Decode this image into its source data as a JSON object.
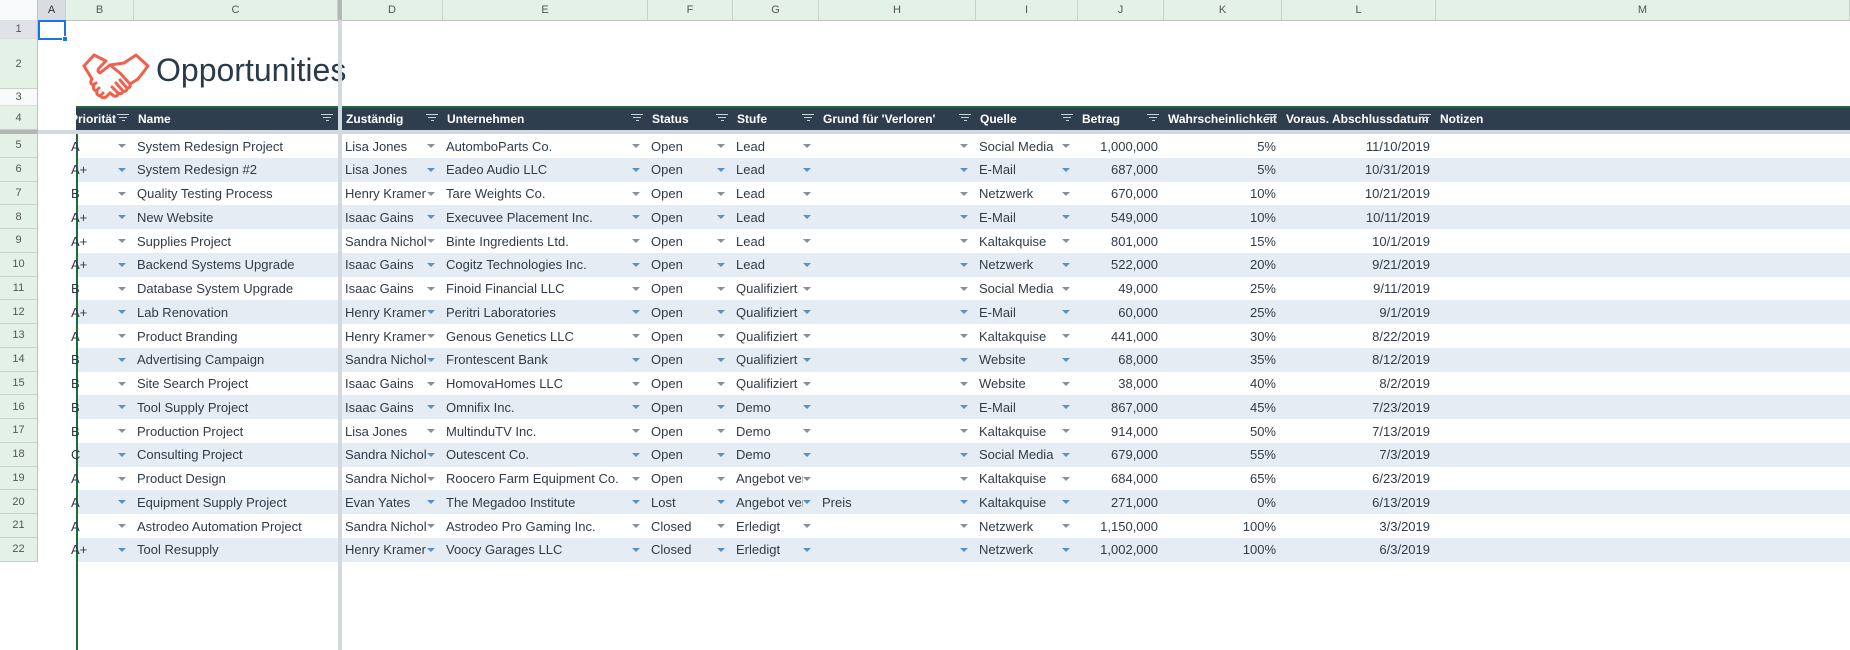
{
  "sheet": {
    "columns": [
      "A",
      "B",
      "C",
      "D",
      "E",
      "F",
      "G",
      "H",
      "I",
      "J",
      "K",
      "L",
      "M"
    ],
    "row_numbers": [
      "1",
      "2",
      "3",
      "4",
      "5",
      "6",
      "7",
      "8",
      "9",
      "10",
      "11",
      "12",
      "13",
      "14",
      "15",
      "16",
      "17",
      "18",
      "19",
      "20",
      "21",
      "22"
    ],
    "selected_cell": "A1"
  },
  "title": {
    "text": "Opportunities",
    "icon": "handshake-icon",
    "icon_color": "#f0604d"
  },
  "table": {
    "headers": [
      "Priorität",
      "Name",
      "Zuständig",
      "Unternehmen",
      "Status",
      "Stufe",
      "Grund für 'Verloren'",
      "Quelle",
      "Betrag",
      "Wahrscheinlichkeit",
      "Voraus. Abschlussdatum",
      "Notizen"
    ],
    "rows": [
      {
        "prio": "A",
        "name": "System Redesign Project",
        "owner": "Lisa Jones",
        "company": "AutomboParts Co.",
        "status": "Open",
        "stage": "Lead",
        "lost_reason": "",
        "source": "Social Media",
        "amount": "1,000,000",
        "probability": "5%",
        "close_date": "11/10/2019",
        "notes": ""
      },
      {
        "prio": "A+",
        "name": "System Redesign #2",
        "owner": "Lisa Jones",
        "company": "Eadeo Audio LLC",
        "status": "Open",
        "stage": "Lead",
        "lost_reason": "",
        "source": "E-Mail",
        "amount": "687,000",
        "probability": "5%",
        "close_date": "10/31/2019",
        "notes": ""
      },
      {
        "prio": "B",
        "name": "Quality Testing Process",
        "owner": "Henry Kramer",
        "company": "Tare Weights Co.",
        "status": "Open",
        "stage": "Lead",
        "lost_reason": "",
        "source": "Netzwerk",
        "amount": "670,000",
        "probability": "10%",
        "close_date": "10/21/2019",
        "notes": ""
      },
      {
        "prio": "A+",
        "name": "New Website",
        "owner": "Isaac Gains",
        "company": "Execuvee Placement Inc.",
        "status": "Open",
        "stage": "Lead",
        "lost_reason": "",
        "source": "E-Mail",
        "amount": "549,000",
        "probability": "10%",
        "close_date": "10/11/2019",
        "notes": ""
      },
      {
        "prio": "A+",
        "name": "Supplies Project",
        "owner": "Sandra Nichols",
        "company": "Binte Ingredients Ltd.",
        "status": "Open",
        "stage": "Lead",
        "lost_reason": "",
        "source": "Kaltakquise",
        "amount": "801,000",
        "probability": "15%",
        "close_date": "10/1/2019",
        "notes": ""
      },
      {
        "prio": "A+",
        "name": "Backend Systems Upgrade",
        "owner": "Isaac Gains",
        "company": "Cogitz Technologies Inc.",
        "status": "Open",
        "stage": "Lead",
        "lost_reason": "",
        "source": "Netzwerk",
        "amount": "522,000",
        "probability": "20%",
        "close_date": "9/21/2019",
        "notes": ""
      },
      {
        "prio": "B",
        "name": "Database System Upgrade",
        "owner": "Isaac Gains",
        "company": "Finoid Financial LLC",
        "status": "Open",
        "stage": "Qualifiziert",
        "lost_reason": "",
        "source": "Social Media",
        "amount": "49,000",
        "probability": "25%",
        "close_date": "9/11/2019",
        "notes": ""
      },
      {
        "prio": "A+",
        "name": "Lab Renovation",
        "owner": "Henry Kramer",
        "company": "Peritri Laboratories",
        "status": "Open",
        "stage": "Qualifiziert",
        "lost_reason": "",
        "source": "E-Mail",
        "amount": "60,000",
        "probability": "25%",
        "close_date": "9/1/2019",
        "notes": ""
      },
      {
        "prio": "A",
        "name": "Product Branding",
        "owner": "Henry Kramer",
        "company": "Genous Genetics LLC",
        "status": "Open",
        "stage": "Qualifiziert",
        "lost_reason": "",
        "source": "Kaltakquise",
        "amount": "441,000",
        "probability": "30%",
        "close_date": "8/22/2019",
        "notes": ""
      },
      {
        "prio": "B",
        "name": "Advertising Campaign",
        "owner": "Sandra Nichols",
        "company": "Frontescent Bank",
        "status": "Open",
        "stage": "Qualifiziert",
        "lost_reason": "",
        "source": "Website",
        "amount": "68,000",
        "probability": "35%",
        "close_date": "8/12/2019",
        "notes": ""
      },
      {
        "prio": "B",
        "name": "Site Search Project",
        "owner": "Isaac Gains",
        "company": "HomovaHomes LLC",
        "status": "Open",
        "stage": "Qualifiziert",
        "lost_reason": "",
        "source": "Website",
        "amount": "38,000",
        "probability": "40%",
        "close_date": "8/2/2019",
        "notes": ""
      },
      {
        "prio": "B",
        "name": "Tool Supply Project",
        "owner": "Isaac Gains",
        "company": "Omnifix Inc.",
        "status": "Open",
        "stage": "Demo",
        "lost_reason": "",
        "source": "E-Mail",
        "amount": "867,000",
        "probability": "45%",
        "close_date": "7/23/2019",
        "notes": ""
      },
      {
        "prio": "B",
        "name": "Production Project",
        "owner": "Lisa Jones",
        "company": "MultinduTV Inc.",
        "status": "Open",
        "stage": "Demo",
        "lost_reason": "",
        "source": "Kaltakquise",
        "amount": "914,000",
        "probability": "50%",
        "close_date": "7/13/2019",
        "notes": ""
      },
      {
        "prio": "C",
        "name": "Consulting Project",
        "owner": "Sandra Nichols",
        "company": "Outescent Co.",
        "status": "Open",
        "stage": "Demo",
        "lost_reason": "",
        "source": "Social Media",
        "amount": "679,000",
        "probability": "55%",
        "close_date": "7/3/2019",
        "notes": ""
      },
      {
        "prio": "A",
        "name": "Product Design",
        "owner": "Sandra Nichols",
        "company": "Roocero Farm Equipment Co.",
        "status": "Open",
        "stage": "Angebot vers",
        "lost_reason": "",
        "source": "Kaltakquise",
        "amount": "684,000",
        "probability": "65%",
        "close_date": "6/23/2019",
        "notes": ""
      },
      {
        "prio": "A",
        "name": "Equipment Supply Project",
        "owner": "Evan Yates",
        "company": "The Megadoo Institute",
        "status": "Lost",
        "stage": "Angebot vers",
        "lost_reason": "Preis",
        "source": "Kaltakquise",
        "amount": "271,000",
        "probability": "0%",
        "close_date": "6/13/2019",
        "notes": ""
      },
      {
        "prio": "A",
        "name": "Astrodeo Automation Project",
        "owner": "Sandra Nichols",
        "company": "Astrodeo Pro Gaming Inc.",
        "status": "Closed",
        "stage": "Erledigt",
        "lost_reason": "",
        "source": "Netzwerk",
        "amount": "1,150,000",
        "probability": "100%",
        "close_date": "3/3/2019",
        "notes": ""
      },
      {
        "prio": "A+",
        "name": "Tool Resupply",
        "owner": "Henry Kramer",
        "company": "Voocy Garages LLC",
        "status": "Closed",
        "stage": "Erledigt",
        "lost_reason": "",
        "source": "Netzwerk",
        "amount": "1,002,000",
        "probability": "100%",
        "close_date": "6/3/2019",
        "notes": ""
      }
    ]
  },
  "colors": {
    "header_bg": "#2e3e4f",
    "band_bg": "#e6ecf3",
    "accent_border": "#1e6b3a",
    "selection": "#1a73e8"
  }
}
